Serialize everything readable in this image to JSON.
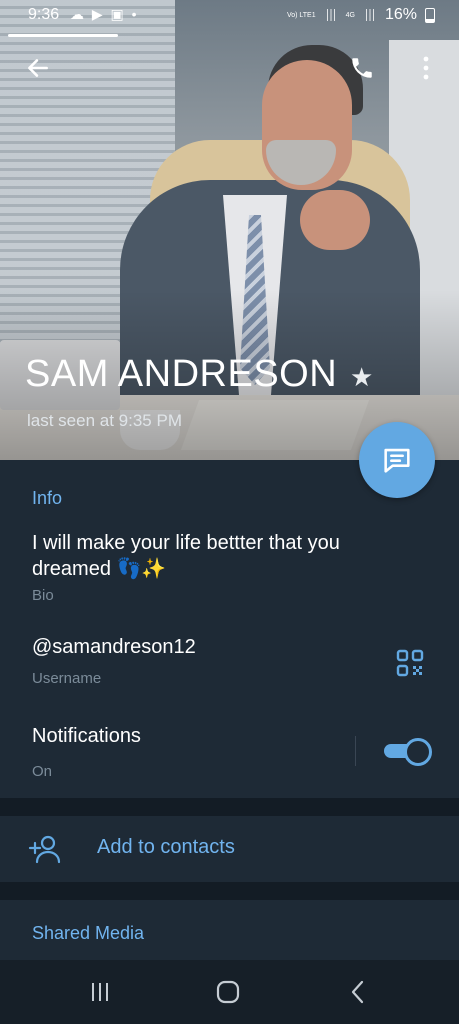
{
  "status_bar": {
    "time": "9:36",
    "left_icons": "☁ ▶ ▣ •",
    "network_tag": "Vo) LTE1",
    "network_type": "4G",
    "battery": "16%"
  },
  "profile": {
    "name": "SAM ANDRESON",
    "last_seen": "last seen at 9:35 PM"
  },
  "info": {
    "section_title": "Info",
    "bio_text": "I will make your life bettter that you dreamed 👣✨",
    "bio_label": "Bio",
    "username": "@samandreson12",
    "username_label": "Username",
    "notifications_label": "Notifications",
    "notifications_value": "On",
    "notifications_enabled": true
  },
  "actions": {
    "add_contact": "Add to contacts"
  },
  "shared_media": {
    "title": "Shared Media"
  },
  "colors": {
    "accent": "#62a8e2",
    "link": "#71b4ef",
    "background": "#1e2a36"
  }
}
